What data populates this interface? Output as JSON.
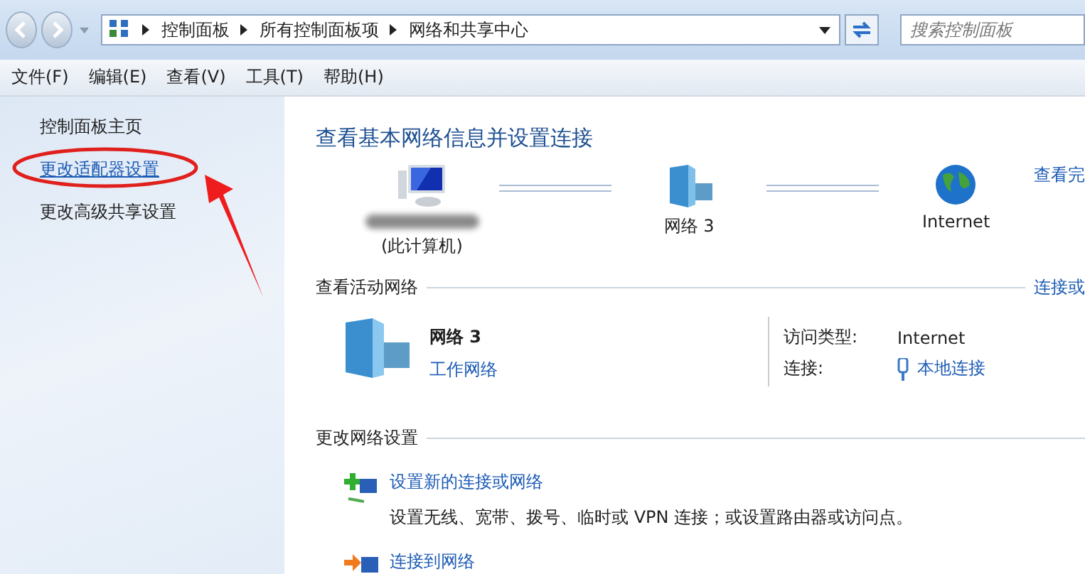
{
  "nav": {
    "address": [
      "控制面板",
      "所有控制面板项",
      "网络和共享中心"
    ],
    "search": {
      "placeholder": "搜索控制面板"
    }
  },
  "menu": [
    "文件(F)",
    "编辑(E)",
    "查看(V)",
    "工具(T)",
    "帮助(H)"
  ],
  "sidebar": {
    "items": [
      {
        "label": "控制面板主页",
        "kind": "plain",
        "circled": false
      },
      {
        "label": "更改适配器设置",
        "kind": "link",
        "circled": true
      },
      {
        "label": "更改高级共享设置",
        "kind": "plain",
        "circled": false
      }
    ]
  },
  "main": {
    "title": "查看基本网络信息并设置连接",
    "map": {
      "nodes": [
        {
          "kind": "computer",
          "label": "(此计算机)"
        },
        {
          "kind": "network",
          "label": "网络  3"
        },
        {
          "kind": "globe",
          "label": "Internet"
        }
      ],
      "link": "查看完"
    },
    "active": {
      "heading": "查看活动网络",
      "link": "连接或",
      "network": {
        "name": "网络  3",
        "type": "工作网络"
      },
      "details": [
        {
          "label": "访问类型:",
          "value": "Internet",
          "kind": "text"
        },
        {
          "label": "连接:",
          "value": "本地连接",
          "kind": "link"
        }
      ]
    },
    "settings": {
      "heading": "更改网络设置",
      "items": [
        {
          "kind": "new",
          "title": "设置新的连接或网络",
          "description": "设置无线、宽带、拨号、临时或 VPN 连接；或设置路由器或访问点。"
        },
        {
          "kind": "connect",
          "title": "连接到网络"
        }
      ]
    }
  }
}
